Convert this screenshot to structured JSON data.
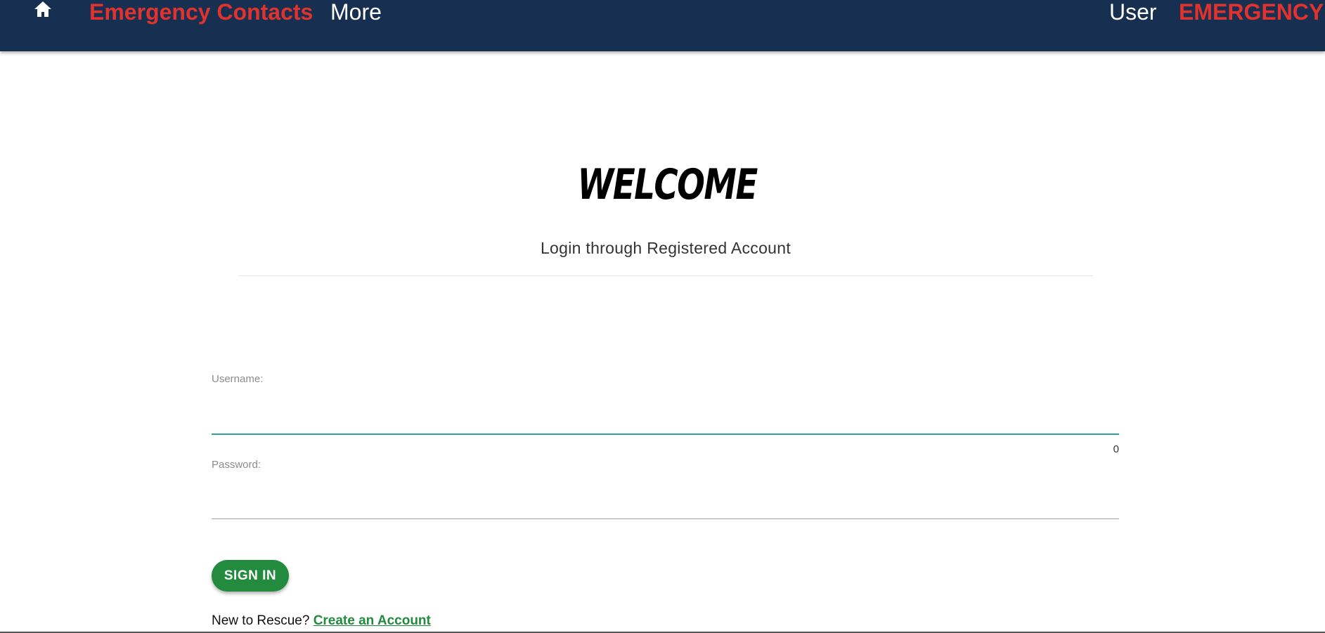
{
  "navbar": {
    "home_icon": "home-icon",
    "emergency_contacts_label": "Emergency Contacts",
    "more_label": "More",
    "user_label": "User",
    "emergency_label": "EMERGENCY",
    "background_color": "#172f50",
    "accent_color": "#e0332e"
  },
  "main": {
    "title": "WELCOME",
    "subtitle": "Login through Registered Account"
  },
  "form": {
    "username_label": "Username:",
    "username_value": "",
    "username_counter": "0",
    "password_label": "Password:",
    "password_value": "",
    "sign_in_label": "SIGN IN",
    "new_user_text": "New to Rescue?",
    "create_account_label": "Create an Account",
    "button_color": "#228b3d",
    "active_field_color": "#26a69a"
  }
}
